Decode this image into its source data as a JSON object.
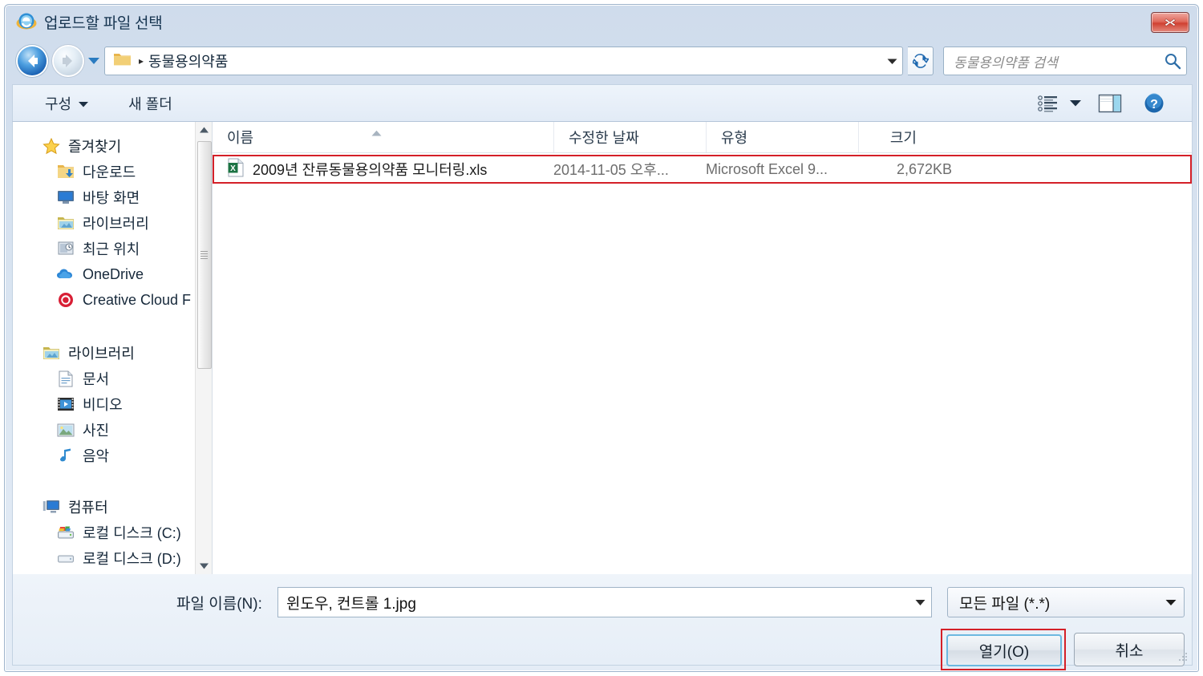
{
  "window": {
    "title": "업로드할 파일 선택",
    "app_icon": "internet-explorer-icon",
    "close_label": "✕"
  },
  "navigation": {
    "back_icon": "back-arrow-icon",
    "forward_icon": "forward-arrow-icon",
    "recent_pages_icon": "chevron-down-icon",
    "address": {
      "folder_icon": "folder-icon",
      "separator": "▸",
      "current_folder": "동물용의약품",
      "dropdown_icon": "chevron-down-icon"
    },
    "refresh_icon": "refresh-icon",
    "search": {
      "placeholder": "동물용의약품 검색",
      "icon": "search-icon"
    }
  },
  "toolbar": {
    "organize_label": "구성",
    "organize_caret": "▼",
    "new_folder_label": "새 폴더",
    "view_mode_icon": "view-list-icon",
    "view_mode_caret": "▼",
    "preview_pane_icon": "preview-pane-icon",
    "help_icon": "help-icon"
  },
  "navigation_pane": {
    "groups": [
      {
        "root": {
          "label": "즐겨찾기",
          "icon": "star-icon"
        },
        "items": [
          {
            "label": "다운로드",
            "icon": "downloads-folder-icon"
          },
          {
            "label": "바탕 화면",
            "icon": "desktop-icon"
          },
          {
            "label": "라이브러리",
            "icon": "library-folder-icon"
          },
          {
            "label": "최근 위치",
            "icon": "recent-places-icon"
          },
          {
            "label": "OneDrive",
            "icon": "onedrive-cloud-icon"
          },
          {
            "label": "Creative Cloud F",
            "icon": "creative-cloud-icon"
          }
        ]
      },
      {
        "root": {
          "label": "라이브러리",
          "icon": "library-folder-icon"
        },
        "items": [
          {
            "label": "문서",
            "icon": "document-icon"
          },
          {
            "label": "비디오",
            "icon": "video-icon"
          },
          {
            "label": "사진",
            "icon": "picture-icon"
          },
          {
            "label": "음악",
            "icon": "music-note-icon"
          }
        ]
      },
      {
        "root": {
          "label": "컴퓨터",
          "icon": "computer-icon"
        },
        "items": [
          {
            "label": "로컬 디스크 (C:)",
            "icon": "system-drive-icon"
          },
          {
            "label": "로컬 디스크 (D:)",
            "icon": "drive-icon"
          }
        ]
      }
    ],
    "scrollbar": {
      "up_arrow": "▲",
      "down_arrow": "▼"
    }
  },
  "file_list": {
    "columns": [
      {
        "label": "이름",
        "key": "name"
      },
      {
        "label": "수정한 날짜",
        "key": "date"
      },
      {
        "label": "유형",
        "key": "type"
      },
      {
        "label": "크기",
        "key": "size"
      }
    ],
    "sort_indicator": "▲",
    "rows": [
      {
        "icon": "excel-file-icon",
        "name": "2009년 잔류동물용의약품 모니터링.xls",
        "date": "2014-11-05 오후...",
        "type": "Microsoft Excel 9...",
        "size": "2,672KB"
      }
    ]
  },
  "footer": {
    "filename_label": "파일 이름(N):",
    "filename_value": "윈도우, 컨트롤 1.jpg",
    "filename_dropdown_icon": "chevron-down-icon",
    "filetype_value": "모든 파일 (*.*)",
    "filetype_dropdown_icon": "chevron-down-icon",
    "open_label": "열기(O)",
    "cancel_label": "취소",
    "resize_grip_icon": "resize-grip-icon"
  },
  "colors": {
    "highlight_box": "#d42028",
    "focus_border": "#6cb8e0",
    "titlebar_text": "#15334f",
    "close_button": "#cf4132"
  }
}
